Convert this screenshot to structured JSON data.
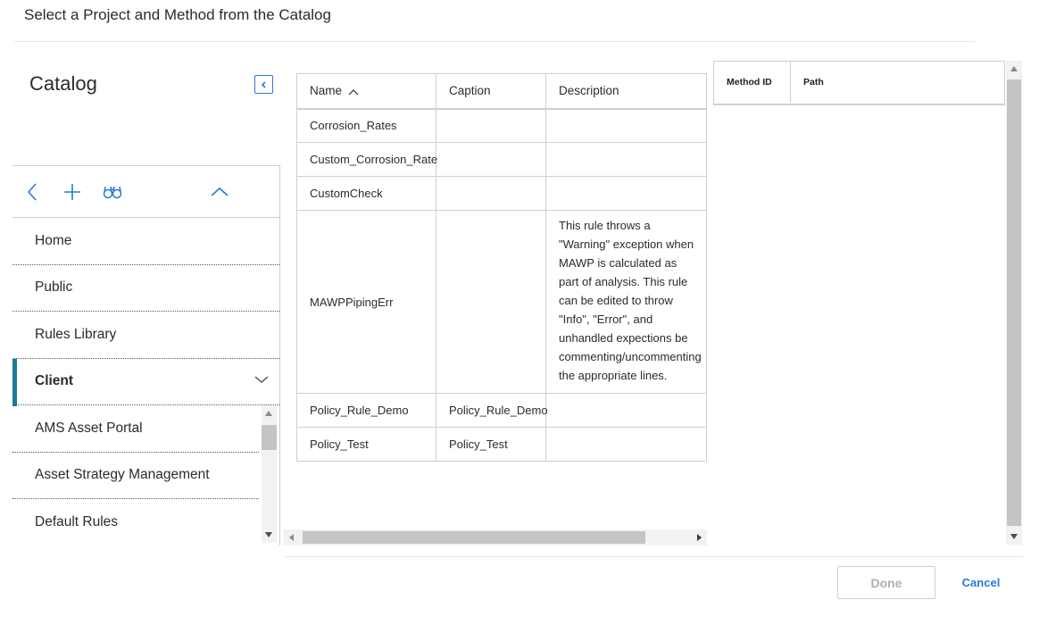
{
  "dialog": {
    "title": "Select a Project and Method from the Catalog"
  },
  "catalog": {
    "heading": "Catalog",
    "nav_items": [
      {
        "label": "Home"
      },
      {
        "label": "Public"
      },
      {
        "label": "Rules Library"
      },
      {
        "label": "Client"
      }
    ],
    "sub_items": [
      {
        "label": "AMS Asset Portal"
      },
      {
        "label": "Asset Strategy Management"
      },
      {
        "label": "Default Rules"
      }
    ],
    "toolbar_icons": [
      "back-icon",
      "add-icon",
      "binoculars-icon",
      "chevron-up-icon"
    ]
  },
  "methods_table": {
    "columns": [
      "Name",
      "Caption",
      "Description"
    ],
    "sort": {
      "column": "Name",
      "direction": "ascending"
    },
    "rows": [
      {
        "name": "Corrosion_Rates",
        "caption": "",
        "description": ""
      },
      {
        "name": "Custom_Corrosion_Rate",
        "caption": "",
        "description": ""
      },
      {
        "name": "CustomCheck",
        "caption": "",
        "description": ""
      },
      {
        "name": "MAWPPipingErr",
        "caption": "",
        "description": "This rule throws a \"Warning\" exception when MAWP is calculated as part of analysis. This rule can be edited to throw \"Info\", \"Error\", and unhandled expections be commenting/uncommenting the appropriate lines."
      },
      {
        "name": "Policy_Rule_Demo",
        "caption": "Policy_Rule_Demo",
        "description": ""
      },
      {
        "name": "Policy_Test",
        "caption": "Policy_Test",
        "description": ""
      }
    ]
  },
  "selected_grid": {
    "columns": [
      "Method ID",
      "Path"
    ]
  },
  "footer": {
    "done_label": "Done",
    "cancel_label": "Cancel"
  },
  "colors": {
    "accent": "#2a7ad3",
    "active_marker": "#1a7a9a",
    "disabled_text": "#b0b0b0"
  }
}
